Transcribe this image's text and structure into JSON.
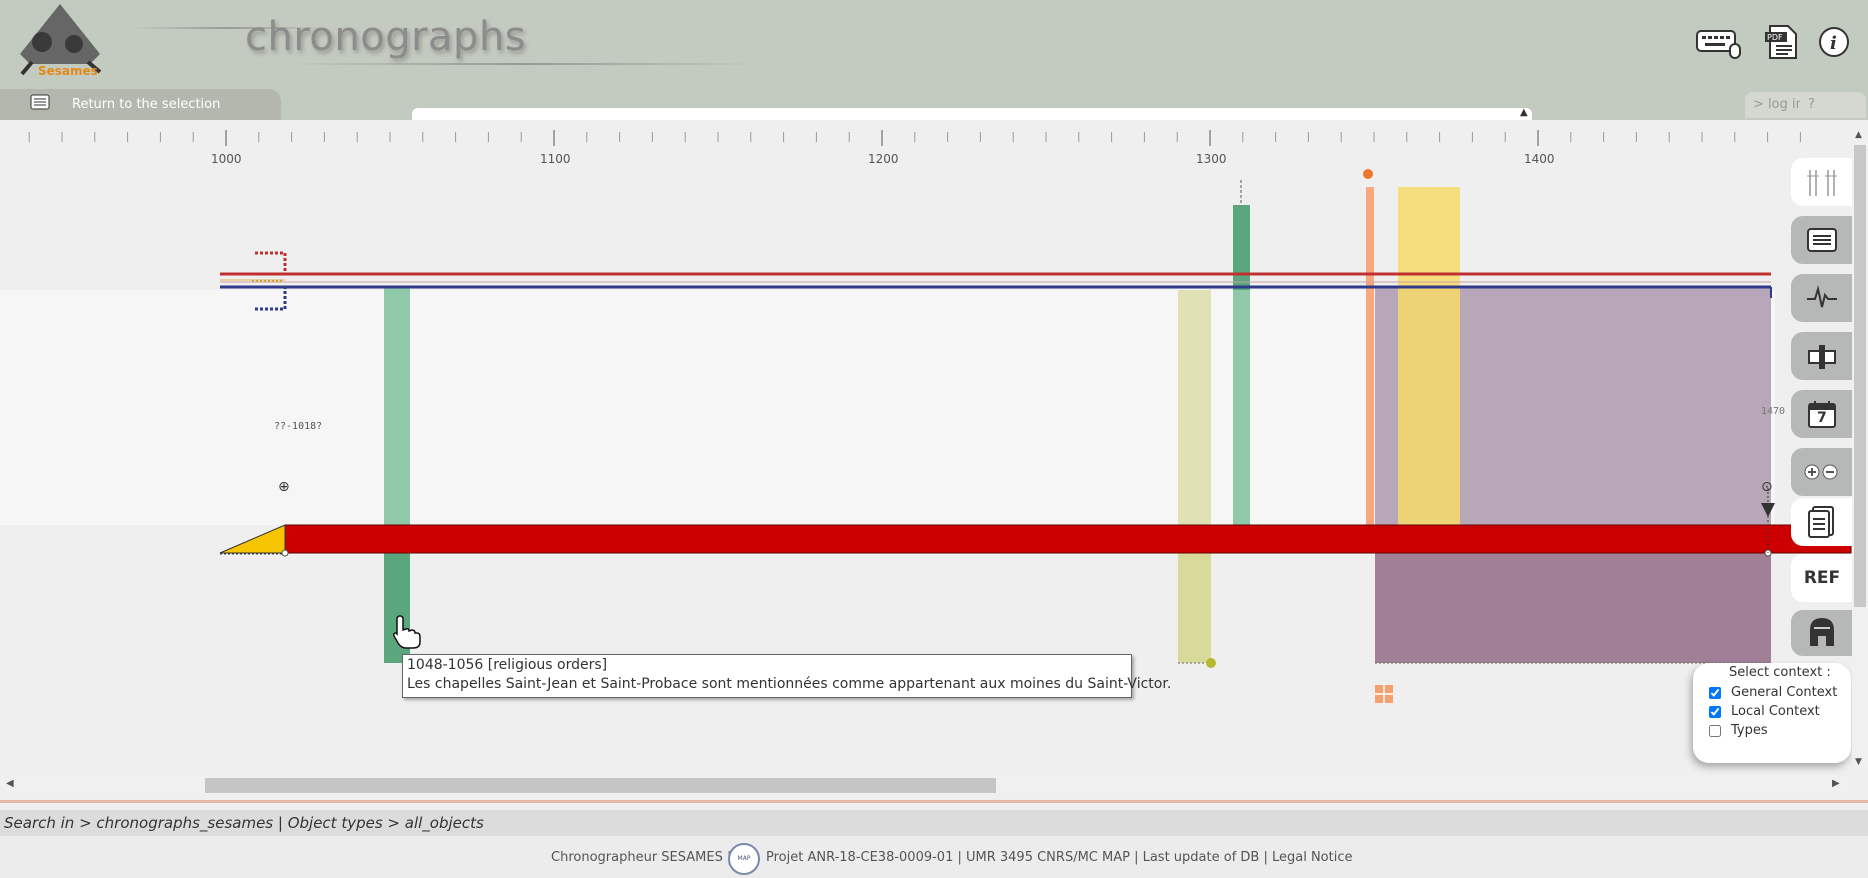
{
  "header": {
    "logo_text": "Sesames",
    "title": "chronographs",
    "return_label": "Return to the selection",
    "login_label": "> log in",
    "help_label": "? ———",
    "icons": [
      "keyboard-mouse-icon",
      "pdf-icon",
      "info-icon"
    ]
  },
  "ruler": {
    "years": [
      "1000",
      "1100",
      "1200",
      "1300",
      "1400"
    ]
  },
  "timeline": {
    "start_label": "??-1018?",
    "end_label": "1470"
  },
  "toolbar": {
    "ref_label": "REF",
    "calendar_number": "7",
    "icons": [
      "scale-icon",
      "list-icon",
      "pulse-icon",
      "cropper-icon",
      "calendar-icon",
      "zoom-icon",
      "document-icon",
      "ref-icon",
      "helmet-icon"
    ]
  },
  "context": {
    "title": "Select context :",
    "options": [
      {
        "label": "General Context",
        "checked": true
      },
      {
        "label": "Local Context",
        "checked": true
      },
      {
        "label": "Types",
        "checked": false
      }
    ]
  },
  "tooltip": {
    "line1": "1048-1056  [religious orders]",
    "line2": "Les chapelles Saint-Jean et Saint-Probace sont mentionnées comme appartenant aux moines du Saint-Victor."
  },
  "search": {
    "text": "Search in > chronographs_sesames | Object types > all_objects"
  },
  "footer": {
    "left": "Chronographeur SESAMES |",
    "right": "Projet ANR-18-CE38-0009-01 | UMR 3495 CNRS/MC MAP | Last update of DB | Legal Notice",
    "logo_text": "MAP"
  },
  "colors": {
    "header_bg": "#c3cac0",
    "red_bar": "#cc0000",
    "green_bar": "#5aa77e",
    "purple_band": "#a07f97",
    "yellow_band": "#f7d96a",
    "orange_bar": "#f9a77d",
    "olive_band": "#d8da9a"
  }
}
